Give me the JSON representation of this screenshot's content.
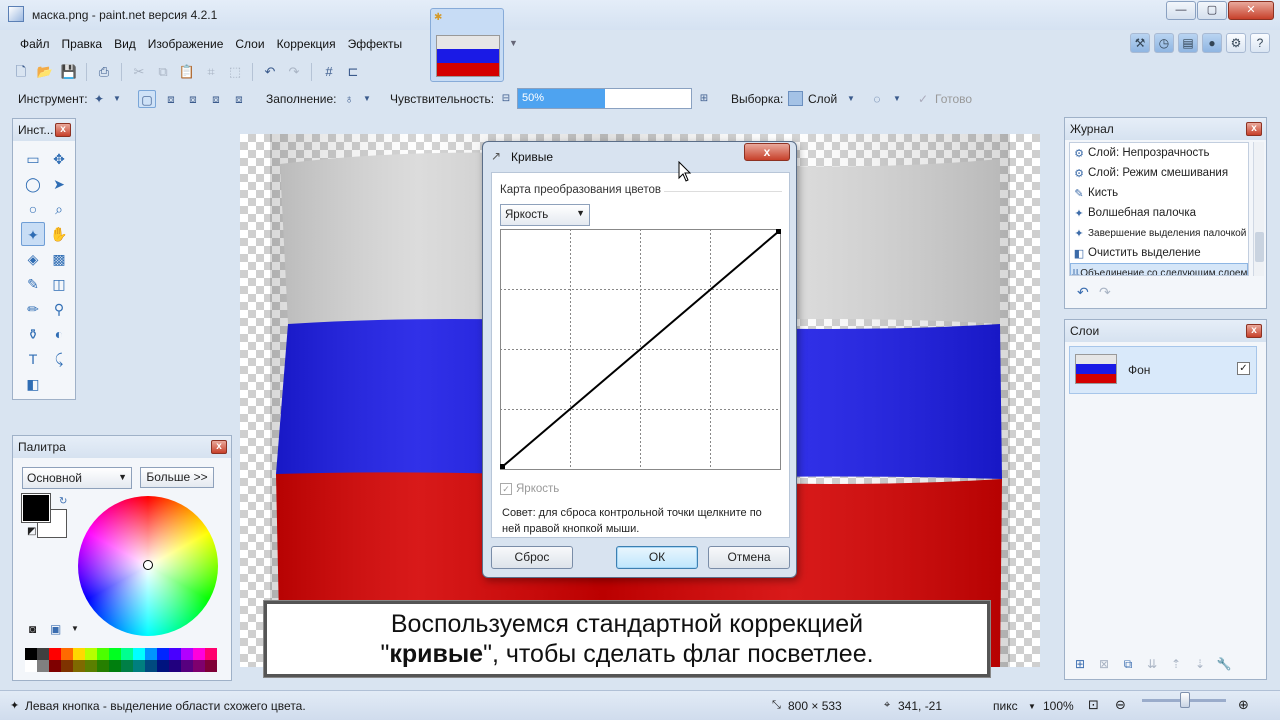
{
  "window": {
    "title": "маска.png - paint.net версия 4.2.1",
    "controls": [
      "—",
      "▢",
      "✕"
    ]
  },
  "menu": [
    "Файл",
    "Правка",
    "Вид",
    "Изображение",
    "Слои",
    "Коррекция",
    "Эффекты"
  ],
  "toolbar2": {
    "tool_label": "Инструмент:",
    "fill_label": "Заполнение:",
    "sensitivity_label": "Чувствительность:",
    "sensitivity_value": "50%",
    "sensitivity_fraction": 0.5,
    "selection_label": "Выборка:",
    "selection_value": "Слой",
    "done_label": "Готово"
  },
  "tools_panel": {
    "title": "Инст..."
  },
  "history_panel": {
    "title": "Журнал",
    "items": [
      "Слой: Непрозрачность",
      "Слой: Режим смешивания",
      "Кисть",
      "Волшебная палочка",
      "Завершение выделения палочкой",
      "Очистить выделение",
      "Объединение со следующим слоем"
    ]
  },
  "layers_panel": {
    "title": "Слои",
    "layers": [
      {
        "name": "Фон",
        "visible": "✓"
      }
    ]
  },
  "palette_panel": {
    "title": "Палитра",
    "mode": "Основной",
    "more_button": "Больше >>",
    "colors": [
      "#000000",
      "#404040",
      "#ff0000",
      "#ff6a00",
      "#ffd800",
      "#b6ff00",
      "#4cff00",
      "#00ff21",
      "#00ff90",
      "#00ffff",
      "#0094ff",
      "#0026ff",
      "#4800ff",
      "#b200ff",
      "#ff00dc",
      "#ff006e",
      "#ffffff",
      "#808080",
      "#7f0000",
      "#7f3300",
      "#7f6a00",
      "#5b7f00",
      "#267f00",
      "#007f0e",
      "#007f46",
      "#007f7f",
      "#004a7f",
      "#00137f",
      "#21007f",
      "#57007f",
      "#7f006e",
      "#7f0037"
    ]
  },
  "dialog": {
    "title": "Кривые",
    "section": "Карта преобразования цветов",
    "mode": "Яркость",
    "checkbox_label": "Яркость",
    "hint": "Совет: для сброса контрольной точки щелкните по ней правой кнопкой мыши.",
    "reset_button": "Сброс",
    "ok_button": "ОК",
    "cancel_button": "Отмена"
  },
  "caption": {
    "line1": "Воспользуемся стандартной коррекцией",
    "line2_quote_open": "\"",
    "line2_bold": "кривые",
    "line2_rest": "\", чтобы сделать флаг посветлее."
  },
  "status": {
    "hint": "Левая кнопка - выделение области схожего цвета.",
    "image_size": "800 × 533",
    "cursor_pos": "341, -21",
    "units": "пикс",
    "zoom": "100%"
  },
  "colors": {
    "flag_white": "#e6e6e6",
    "flag_blue": "#1a1ae6",
    "flag_red": "#d40000",
    "accent": "#4ea3f0"
  }
}
